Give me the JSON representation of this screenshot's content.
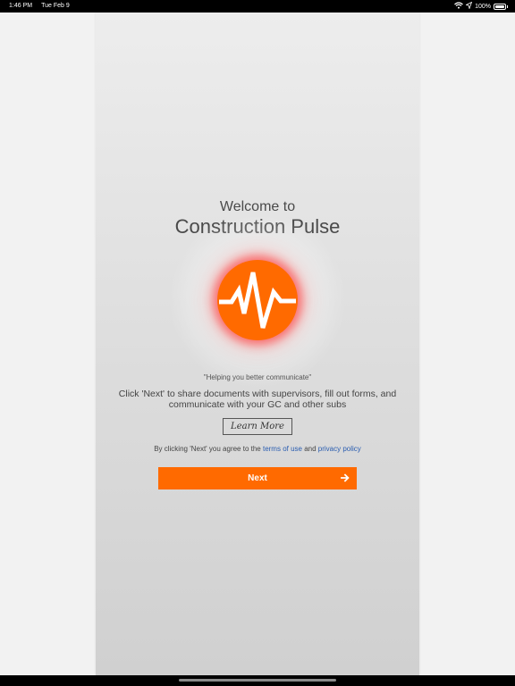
{
  "status_bar": {
    "time": "1:46 PM",
    "date": "Tue Feb 9",
    "battery_percent": "100%",
    "icons": [
      "wifi-icon",
      "location-icon",
      "battery-icon"
    ]
  },
  "welcome": {
    "line1": "Welcome to",
    "line2": "Construction Pulse"
  },
  "logo": {
    "icon": "pulse-icon",
    "color": "#ff6a00"
  },
  "tagline": "\"Helping you better communicate\"",
  "description": "Click 'Next' to share documents with supervisors, fill out forms, and communicate with your GC and other subs",
  "learn_more_label": "Learn More",
  "agreement": {
    "prefix": "By clicking 'Next' you agree to the ",
    "terms_link": "terms of use",
    "conjunction": " and ",
    "privacy_link": "privacy policy"
  },
  "next_button": {
    "label": "Next",
    "icon": "arrow-right-icon",
    "color": "#ff6a00"
  }
}
